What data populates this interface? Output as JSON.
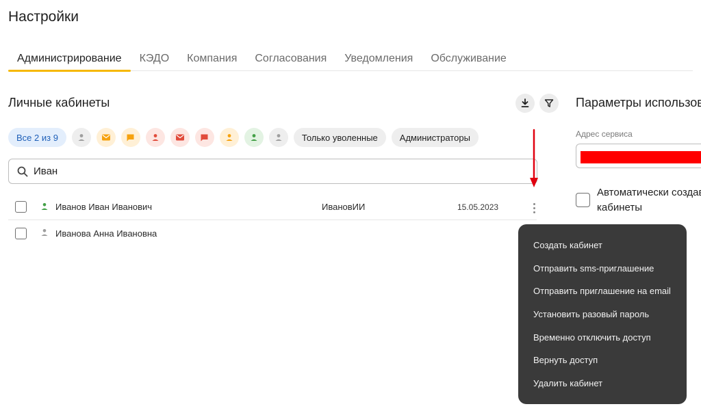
{
  "page": {
    "title": "Настройки"
  },
  "tabs": [
    "Администрирование",
    "КЭДО",
    "Компания",
    "Согласования",
    "Уведомления",
    "Обслуживание"
  ],
  "active_tab": "Администрирование",
  "left": {
    "title": "Личные кабинеты",
    "chips": {
      "all": "Все 2 из 9",
      "only_fired": "Только уволенные",
      "admins": "Администраторы"
    },
    "status_icons": [
      {
        "icon": "person-icon",
        "color": "#9e9e9e",
        "bg": "#eeeeee"
      },
      {
        "icon": "email-icon",
        "color": "#ffffff",
        "bg": "#fff0d6",
        "fg": "#f6a20e"
      },
      {
        "icon": "chat-icon",
        "color": "#ffffff",
        "bg": "#fff0d6",
        "fg": "#f6a20e"
      },
      {
        "icon": "person-icon",
        "color": "#e14b3b",
        "bg": "#fde6e2"
      },
      {
        "icon": "email-icon",
        "color": "#ffffff",
        "bg": "#fde6e2",
        "fg": "#e14b3b"
      },
      {
        "icon": "chat-icon",
        "color": "#ffffff",
        "bg": "#fde6e2",
        "fg": "#e14b3b"
      },
      {
        "icon": "person-icon",
        "color": "#f6a20e",
        "bg": "#fff0d6"
      },
      {
        "icon": "person-icon",
        "color": "#43a047",
        "bg": "#e3f3e3"
      },
      {
        "icon": "person-icon",
        "color": "#9e9e9e",
        "bg": "#eeeeee"
      }
    ],
    "search_value": "Иван",
    "rows": [
      {
        "name": "Иванов Иван Иванович",
        "login": "ИвановИИ",
        "date": "15.05.2023",
        "status_color": "#43a047"
      },
      {
        "name": "Иванова Анна Ивановна",
        "login": "",
        "date": "",
        "status_color": "#9e9e9e"
      }
    ]
  },
  "right": {
    "title": "Параметры использования",
    "address_label": "Адрес сервиса",
    "auto_label_line1": "Автоматически создавать",
    "auto_label_line2": "кабинеты"
  },
  "context_menu": [
    "Создать кабинет",
    "Отправить sms-приглашение",
    "Отправить приглашение на email",
    "Установить разовый пароль",
    "Временно отключить доступ",
    "Вернуть доступ",
    "Удалить кабинет"
  ],
  "colors": {
    "accent": "#f6b800",
    "menu_bg": "#3a3a3a",
    "annotation": "#e0000f",
    "redaction": "#ff0000"
  }
}
